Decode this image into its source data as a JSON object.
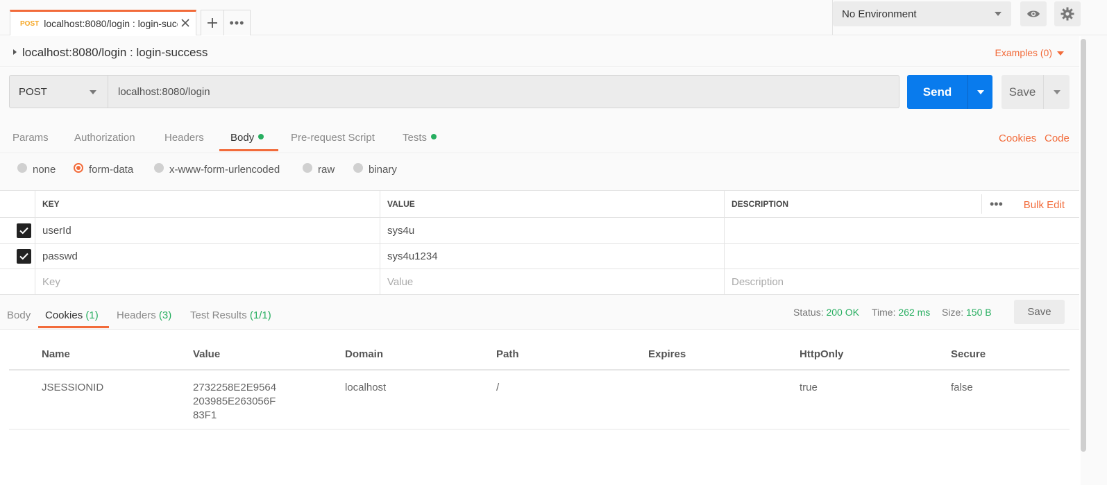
{
  "tab": {
    "method": "POST",
    "title": "localhost:8080/login : login-success"
  },
  "environment": {
    "selected": "No Environment"
  },
  "request": {
    "name": "localhost:8080/login : login-success",
    "examples": "Examples (0)",
    "method": "POST",
    "url": "localhost:8080/login",
    "send_label": "Send",
    "save_label": "Save"
  },
  "req_tabs": {
    "params": "Params",
    "authorization": "Authorization",
    "headers": "Headers",
    "body": "Body",
    "prerequest": "Pre-request Script",
    "tests": "Tests",
    "cookies_link": "Cookies",
    "code_link": "Code"
  },
  "body_types": {
    "none": "none",
    "form_data": "form-data",
    "urlencoded": "x-www-form-urlencoded",
    "raw": "raw",
    "binary": "binary",
    "selected": "form-data"
  },
  "params_table": {
    "headers": {
      "key": "KEY",
      "value": "VALUE",
      "description": "DESCRIPTION",
      "bulk_edit": "Bulk Edit"
    },
    "rows": [
      {
        "checked": true,
        "key": "userId",
        "value": "sys4u",
        "description": ""
      },
      {
        "checked": true,
        "key": "passwd",
        "value": "sys4u1234",
        "description": ""
      }
    ],
    "placeholders": {
      "key": "Key",
      "value": "Value",
      "description": "Description"
    }
  },
  "response": {
    "tabs": {
      "body": "Body",
      "cookies": "Cookies",
      "cookies_count": "(1)",
      "headers": "Headers",
      "headers_count": "(3)",
      "tests": "Test Results",
      "tests_count": "(1/1)"
    },
    "status_label": "Status:",
    "status": "200 OK",
    "time_label": "Time:",
    "time": "262 ms",
    "size_label": "Size:",
    "size": "150 B",
    "save_label": "Save",
    "cookies_table": {
      "headers": [
        "Name",
        "Value",
        "Domain",
        "Path",
        "Expires",
        "HttpOnly",
        "Secure"
      ],
      "rows": [
        {
          "name": "JSESSIONID",
          "value": "2732258E2E9564203985E263056F83F1",
          "domain": "localhost",
          "path": "/",
          "expires": "",
          "httponly": "true",
          "secure": "false"
        }
      ]
    }
  },
  "colors": {
    "accent": "#f26b3a",
    "send": "#097bed",
    "success": "#27ae60",
    "method_post": "#f5a623"
  },
  "icons": [
    "close-icon",
    "plus-icon",
    "more-icon",
    "eye-icon",
    "gear-icon",
    "check-icon",
    "caret-down-icon"
  ]
}
